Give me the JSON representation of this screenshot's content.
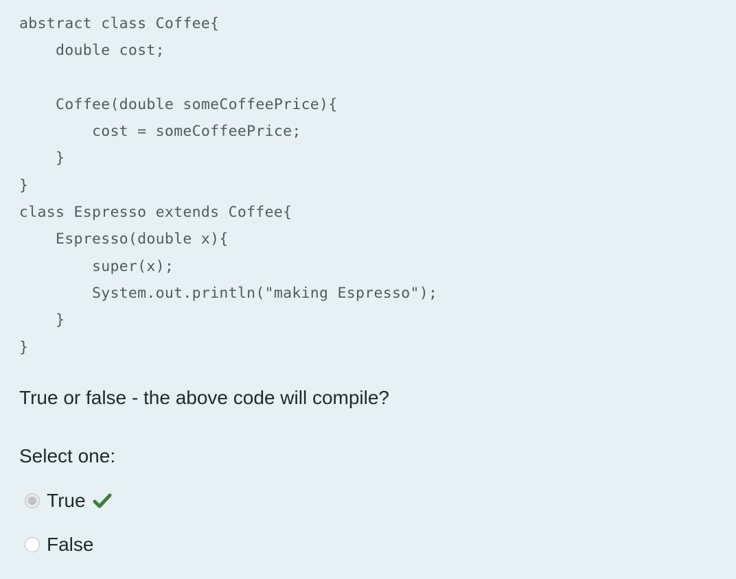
{
  "code": {
    "lines": [
      "abstract class Coffee{",
      "    double cost;",
      "",
      "    Coffee(double someCoffeePrice){",
      "        cost = someCoffeePrice;",
      "    }",
      "}",
      "class Espresso extends Coffee{",
      "    Espresso(double x){",
      "        super(x);",
      "        System.out.println(\"making Espresso\");",
      "    }",
      "}"
    ]
  },
  "question": {
    "text": "True or false - the above code will compile?"
  },
  "answer": {
    "prompt": "Select one:",
    "options": [
      {
        "label": "True",
        "selected": true,
        "marked_correct": true
      },
      {
        "label": "False",
        "selected": false,
        "marked_correct": false
      }
    ]
  },
  "icons": {
    "correct": "checkmark-icon"
  },
  "colors": {
    "background": "#e7f0f3",
    "code_text": "#505b63",
    "body_text": "#1f2a2f",
    "correct_check": "#3f7d3a"
  }
}
